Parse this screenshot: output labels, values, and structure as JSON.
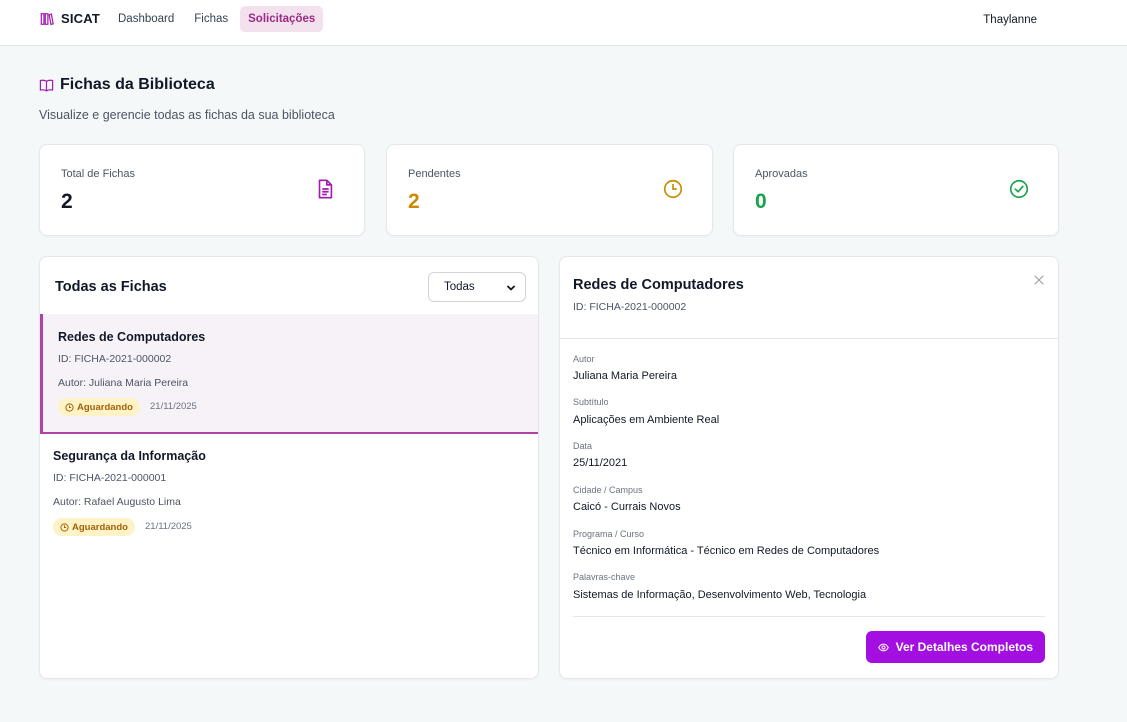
{
  "app": {
    "name": "SICAT",
    "user": "Thaylanne"
  },
  "nav": {
    "items": [
      "Dashboard",
      "Fichas",
      "Solicitações"
    ],
    "active": "Solicitações"
  },
  "header": {
    "title": "Fichas da Biblioteca",
    "subtitle": "Visualize e gerencie todas as fichas da sua biblioteca"
  },
  "stats": [
    {
      "label": "Total de Fichas",
      "value": "2",
      "color": "#111827",
      "icon": "document-icon",
      "icon_color": "#a21caf"
    },
    {
      "label": "Pendentes",
      "value": "2",
      "color": "#ca8a04",
      "icon": "clock-icon",
      "icon_color": "#ca8a04"
    },
    {
      "label": "Aprovadas",
      "value": "0",
      "color": "#16a34a",
      "icon": "check-circle-icon",
      "icon_color": "#16a34a"
    }
  ],
  "list": {
    "title": "Todas as Fichas",
    "filter": {
      "selected": "Todas"
    },
    "items": [
      {
        "title": "Redes de Computadores",
        "id": "ID: FICHA-2021-000002",
        "author": "Autor: Juliana Maria Pereira",
        "status": "Aguardando",
        "date": "21/11/2025"
      },
      {
        "title": "Segurança da Informação",
        "id": "ID: FICHA-2021-000001",
        "author": "Autor: Rafael Augusto Lima",
        "status": "Aguardando",
        "date": "21/11/2025"
      }
    ]
  },
  "detail": {
    "title": "Redes de Computadores",
    "id": "ID: FICHA-2021-000002",
    "fields": [
      {
        "label": "Autor",
        "value": "Juliana Maria Pereira"
      },
      {
        "label": "Subtítulo",
        "value": "Aplicações em Ambiente Real"
      },
      {
        "label": "Data",
        "value": "25/11/2021"
      },
      {
        "label": "Cidade / Campus",
        "value": "Caicó - Currais Novos"
      },
      {
        "label": "Programa / Curso",
        "value": "Técnico em Informática - Técnico em Redes de Computadores"
      },
      {
        "label": "Palavras-chave",
        "value": "Sistemas de Informação, Desenvolvimento Web, Tecnologia"
      }
    ],
    "action_label": "Ver Detalhes Completos"
  },
  "colors": {
    "accent": "#a20fe0",
    "brand": "#9b2b84",
    "pending_badge_bg": "#fef3c7"
  }
}
